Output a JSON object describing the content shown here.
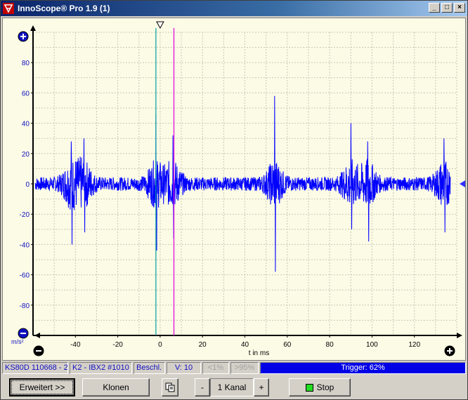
{
  "window": {
    "title": "InnoScope® Pro 1.9 (1)",
    "buttons": [
      "_",
      "□",
      "×"
    ]
  },
  "plot": {
    "y_ticks": [
      "80",
      "60",
      "40",
      "20",
      "0",
      "-20",
      "-40",
      "-60",
      "-80"
    ],
    "x_ticks": [
      "-40",
      "-20",
      "0",
      "20",
      "40",
      "60",
      "80",
      "100",
      "120"
    ],
    "y_unit": "m/s²",
    "x_label": "t in ms",
    "zoom_plus_label": "+",
    "zoom_minus_label": "−",
    "colors": {
      "signal": "#0000ff",
      "cursor_cyan": "#00a0a0",
      "cursor_magenta": "#e000e0",
      "background": "#fbfbe6",
      "grid": "#c8c8b4"
    }
  },
  "chart_data": {
    "type": "line",
    "xlabel": "t in ms",
    "ylabel": "m/s²",
    "xlim": [
      -60,
      140
    ],
    "ylim": [
      -100,
      100
    ],
    "grid": true,
    "series": [
      {
        "values": []
      }
    ],
    "trigger_level": 0,
    "cursor_1_ms": -2,
    "cursor_2_ms": 6.5,
    "bursts": [
      {
        "t": -42,
        "peak_pos": 28,
        "peak_neg": -40
      },
      {
        "t": -36,
        "peak_pos": 30,
        "peak_neg": -32
      },
      {
        "t": -2,
        "peak_pos": 46,
        "peak_neg": -44
      },
      {
        "t": 6,
        "peak_pos": 32,
        "peak_neg": -36
      },
      {
        "t": 54,
        "peak_pos": 58,
        "peak_neg": -58
      },
      {
        "t": 90,
        "peak_pos": 40,
        "peak_neg": -30
      },
      {
        "t": 98,
        "peak_pos": 28,
        "peak_neg": -38
      },
      {
        "t": 134,
        "peak_pos": 30,
        "peak_neg": -32
      }
    ]
  },
  "status": {
    "device": "KS80D 110668 - 2",
    "channel": "K2 - IBX2 #1010",
    "mode": "Beschl.",
    "gain": "V: 10",
    "low": "<1%",
    "high": ">95%",
    "trigger": "Trigger: 62%"
  },
  "buttons": {
    "erweitert": "Erweitert >>",
    "klonen": "Klonen",
    "minus": "-",
    "kanal": "1 Kanal",
    "plus": "+",
    "stop": "Stop"
  }
}
